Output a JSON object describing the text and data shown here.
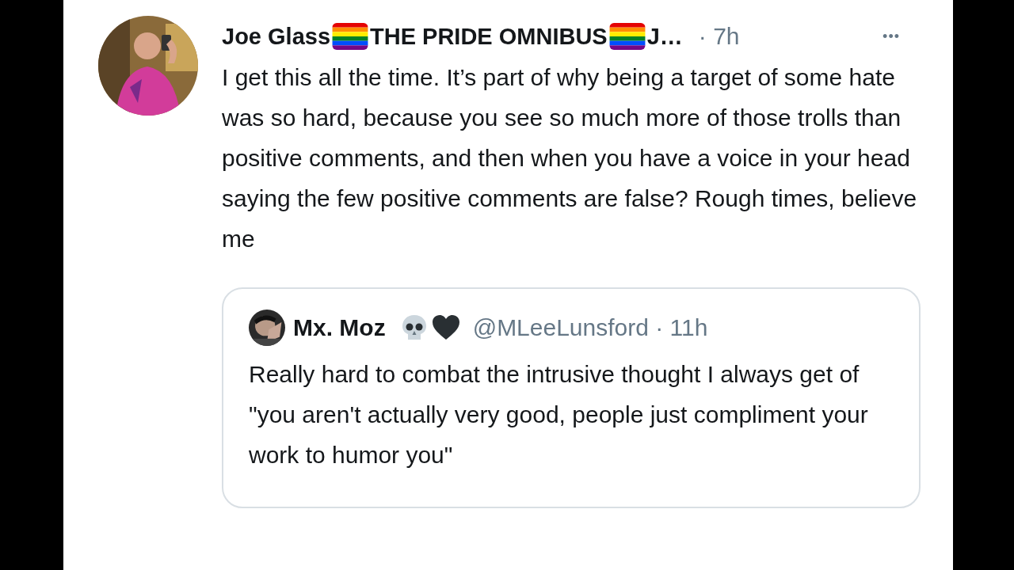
{
  "tweet": {
    "author": {
      "name_parts": [
        "Joe Glass",
        "THE PRIDE OMNIBUS",
        "J…"
      ],
      "time": "· 7h"
    },
    "more": "•••",
    "text": "I get this all the time. It’s part of why being a target of some hate was so hard, because you see so much more of those trolls than positive comments, and then when you have a voice in your head saying the few positive comments are false? Rough times, believe me",
    "quoted": {
      "name": "Mx. Moz",
      "handle_time": "@MLeeLunsford · 11h",
      "text": "Really hard to combat the intrusive thought I always get of \"you aren't actually very good, people just compliment your work to humor you\""
    }
  }
}
